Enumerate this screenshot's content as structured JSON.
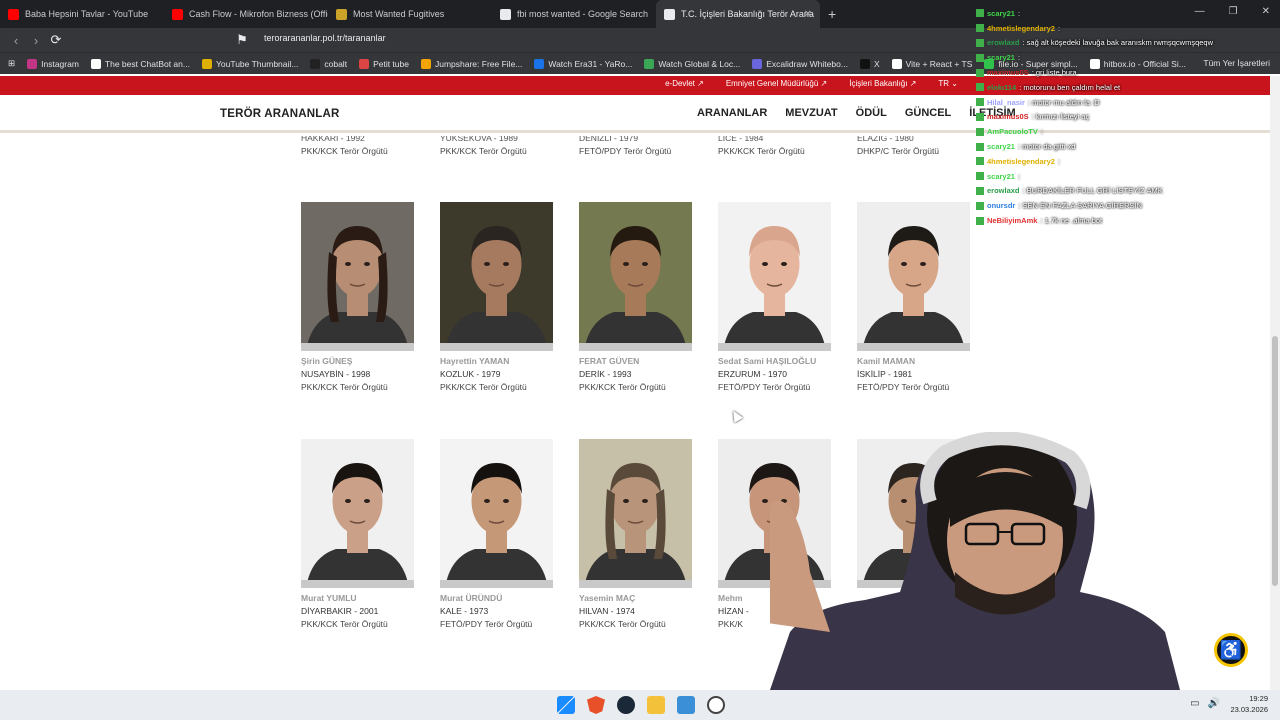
{
  "browser": {
    "tabs": [
      {
        "title": "Baba Hepsini Tavlar - YouTube",
        "favicon_color": "#ff0000"
      },
      {
        "title": "Cash Flow - Mikrofon Bizness (Officia",
        "favicon_color": "#ff0000"
      },
      {
        "title": "Most Wanted Fugitives",
        "favicon_color": "#c9a227"
      },
      {
        "title": "fbi most wanted - Google Search",
        "favicon_color": "#e8eaed"
      },
      {
        "title": "T.C. İçişleri Bakanlığı Terör Arana",
        "favicon_color": "#e8eaed"
      }
    ],
    "new_tab_label": "+",
    "url": "terorarananlar.pol.tr/tarananlar",
    "bookmarks": [
      {
        "label": "Instagram",
        "color": "#c13584"
      },
      {
        "label": "The best ChatBot an...",
        "color": "#ffffff"
      },
      {
        "label": "YouTube Thumbnail...",
        "color": "#e0b000"
      },
      {
        "label": "cobalt",
        "color": "#222222"
      },
      {
        "label": "Petit tube",
        "color": "#d44"
      },
      {
        "label": "Jumpshare: Free File...",
        "color": "#f4a300"
      },
      {
        "label": "Watch Era31 - YaRo...",
        "color": "#1a73e8"
      },
      {
        "label": "Watch Global & Loc...",
        "color": "#3aa757"
      },
      {
        "label": "Excalidraw Whitebo...",
        "color": "#6965db"
      },
      {
        "label": "X",
        "color": "#111111"
      },
      {
        "label": "Vite + React + TS",
        "color": "#ffffff"
      },
      {
        "label": "file.io - Super simpl...",
        "color": "#31c24d"
      },
      {
        "label": "hitbox.io - Official Si...",
        "color": "#ffffff"
      }
    ],
    "bookmarks_right": "Tüm Yer İşaretleri"
  },
  "site": {
    "top_links": [
      "e-Devlet ↗",
      "Emniyet Genel Müdürlüğü ↗",
      "İçişleri Bakanlığı ↗",
      "TR ⌄"
    ],
    "logo": "TERÖR ARANANLAR",
    "nav": [
      "ARANANLAR",
      "MEVZUAT",
      "ÖDÜL",
      "GÜNCEL",
      "İLETİŞİM"
    ]
  },
  "prev_row": [
    {
      "location": "HAKKARİ - 1992",
      "org": "PKK/KCK Terör Örgütü"
    },
    {
      "location": "YÜKSEKOVA - 1989",
      "org": "PKK/KCK Terör Örgütü"
    },
    {
      "location": "DENİZLİ - 1979",
      "org": "FETÖ/PDY Terör Örgütü"
    },
    {
      "location": "LİCE - 1984",
      "org": "PKK/KCK Terör Örgütü"
    },
    {
      "location": "ELAZIĞ - 1980",
      "org": "DHKP/C Terör Örgütü"
    }
  ],
  "row1": [
    {
      "name": "Şirin GÜNEŞ",
      "location": "NUSAYBİN - 1998",
      "org": "PKK/KCK Terör Örgütü",
      "bg": "#6f6a64",
      "face": "#b78e74",
      "hair": "#2a1c14"
    },
    {
      "name": "Hayrettin YAMAN",
      "location": "KOZLUK - 1979",
      "org": "PKK/KCK Terör Örgütü",
      "bg": "#3d3a2c",
      "face": "#a57a5f",
      "hair": "#2a2520"
    },
    {
      "name": "FERAT GÜVEN",
      "location": "DERİK - 1993",
      "org": "PKK/KCK Terör Örgütü",
      "bg": "#75794f",
      "face": "#a77a5a",
      "hair": "#241a10"
    },
    {
      "name": "Sedat Sami HAŞILOĞLU",
      "location": "ERZURUM - 1970",
      "org": "FETÖ/PDY Terör Örgütü",
      "bg": "#f2f2f2",
      "face": "#e6b59d",
      "hair": "#d9a68d"
    },
    {
      "name": "Kamil MAMAN",
      "location": "İSKİLİP - 1981",
      "org": "FETÖ/PDY Terör Örgütü",
      "bg": "#eeeeee",
      "face": "#d7a587",
      "hair": "#1e1a16"
    }
  ],
  "row2": [
    {
      "name": "Murat YUMLU",
      "location": "DİYARBAKIR - 2001",
      "org": "PKK/KCK Terör Örgütü",
      "bg": "#f0f0f0",
      "face": "#caa088",
      "hair": "#1a1410"
    },
    {
      "name": "Murat ÜRÜNDÜ",
      "location": "KALE - 1973",
      "org": "FETÖ/PDY Terör Örgütü",
      "bg": "#f3f3f3",
      "face": "#c59878",
      "hair": "#15110e"
    },
    {
      "name": "Yasemin MAÇ",
      "location": "HILVAN - 1974",
      "org": "PKK/KCK Terör Örgütü",
      "bg": "#c7c0a8",
      "face": "#b8957a",
      "hair": "#5a4a3a"
    },
    {
      "name": "Mehm",
      "location": "HİZAN -",
      "org": "PKK/K",
      "bg": "#ededed",
      "face": "#c7967a",
      "hair": "#1c1714"
    },
    {
      "name": "",
      "location": "",
      "org": "",
      "bg": "#eeeeee",
      "face": "#b98f72",
      "hair": "#2b241f"
    }
  ],
  "chat": [
    {
      "user": "scary21",
      "msg": ":",
      "color": "#3fd44a"
    },
    {
      "user": "4hmetislegendary2",
      "msg": ":",
      "color": "#e0b000"
    },
    {
      "user": "erowlaxd",
      "msg": ": sağ alt köşedeki lavuğa bak aranıskm rwmşqcwmşqeqw",
      "color": "#2a9d4a"
    },
    {
      "user": "scary21",
      "msg": ":",
      "color": "#3fd44a"
    },
    {
      "user": "maximus0S",
      "msg": ": gri liste bura",
      "color": "#d02020"
    },
    {
      "user": "elokı114",
      "msg": ": motorunu ben çaldım helal et",
      "color": "#2a9d4a"
    },
    {
      "user": "Hilal_nasir",
      "msg": ": motor mu aldın la :D",
      "color": "#9aa0ff"
    },
    {
      "user": "maximus0S",
      "msg": ": kırmızı listeyi aç",
      "color": "#d02020"
    },
    {
      "user": "AmPacuoloTV",
      "msg": ":",
      "color": "#3fd44a"
    },
    {
      "user": "scary21",
      "msg": ": motor da gitti xd",
      "color": "#3fd44a"
    },
    {
      "user": "4hmetislegendary2",
      "msg": ":",
      "color": "#e0b000"
    },
    {
      "user": "scary21",
      "msg": ":",
      "color": "#3fd44a"
    },
    {
      "user": "erowlaxd",
      "msg": ": BURDAKİLER FULL GRİ LİSTEYİZ AMK",
      "color": "#2a9d4a"
    },
    {
      "user": "onursdr",
      "msg": ": SEN EN FAZLA SARIYA GİRERSİN",
      "color": "#2d7fe0"
    },
    {
      "user": "NeBiliyimAmk",
      "msg": ": 1.7k ne .alma bot",
      "color": "#e03030"
    }
  ],
  "taskbar": {
    "time": "19:29",
    "date": "23.03.2026"
  }
}
